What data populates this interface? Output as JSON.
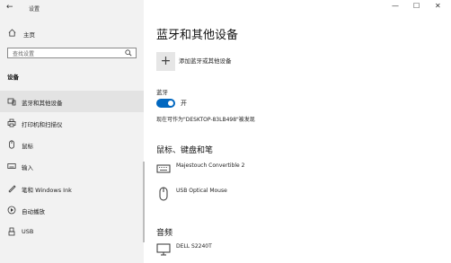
{
  "window": {
    "title": "设置",
    "back_glyph": "←",
    "controls": {
      "minimize": "—",
      "maximize": "☐",
      "close": "✕"
    }
  },
  "sidebar": {
    "home_label": "主页",
    "search_placeholder": "查找设置",
    "section_label": "设备",
    "items": [
      {
        "label": "蓝牙和其他设备",
        "icon": "bluetooth-devices-icon",
        "selected": true
      },
      {
        "label": "打印机和扫描仪",
        "icon": "printer-icon",
        "selected": false
      },
      {
        "label": "鼠标",
        "icon": "mouse-icon",
        "selected": false
      },
      {
        "label": "输入",
        "icon": "keyboard-icon",
        "selected": false
      },
      {
        "label": "笔和 Windows Ink",
        "icon": "pen-icon",
        "selected": false
      },
      {
        "label": "自动播放",
        "icon": "autoplay-icon",
        "selected": false
      },
      {
        "label": "USB",
        "icon": "usb-icon",
        "selected": false
      }
    ]
  },
  "main": {
    "title": "蓝牙和其他设备",
    "add_device_label": "添加蓝牙或其他设备",
    "bluetooth_label": "蓝牙",
    "bluetooth_state": "开",
    "bluetooth_on": true,
    "discoverable_text": "现在可作为\"DESKTOP-83LB498\"被发现",
    "mouse_keyboard_title": "鼠标、键盘和笔",
    "input_devices": [
      {
        "name": "Majestouch Convertible 2",
        "icon": "keyboard-icon"
      },
      {
        "name": "USB Optical Mouse",
        "icon": "mouse-icon"
      }
    ],
    "audio_title": "音频",
    "audio_devices": [
      {
        "name": "DELL S2240T",
        "icon": "monitor-icon"
      }
    ]
  },
  "colors": {
    "accent": "#0067c0",
    "sidebar_bg": "#f2f2f2",
    "selected_bg": "#e3e3e3"
  }
}
